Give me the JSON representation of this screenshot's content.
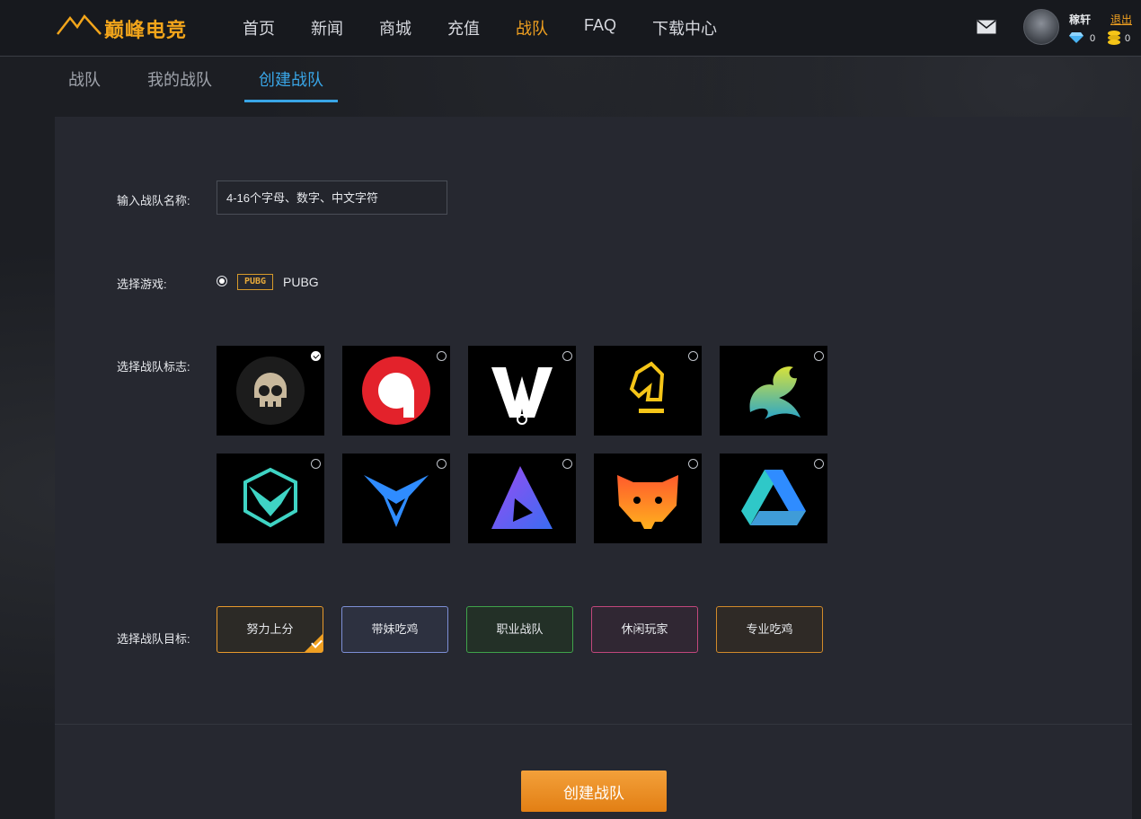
{
  "header": {
    "logo_text": "巅峰电竞",
    "nav": [
      "首页",
      "新闻",
      "商城",
      "充值",
      "战队",
      "FAQ",
      "下载中心"
    ],
    "active_nav": "战队",
    "username": "稼轩",
    "logout": "退出",
    "diamonds": "0",
    "coins": "0"
  },
  "subtabs": {
    "items": [
      "战队",
      "我的战队",
      "创建战队"
    ],
    "active": "创建战队"
  },
  "form": {
    "name_label": "输入战队名称:",
    "name_placeholder": "4-16个字母、数字、中文字符",
    "game_label": "选择游戏:",
    "game_icon_text": "PUBG",
    "game_name": "PUBG",
    "logo_label": "选择战队标志:",
    "logo_selected_index": 0,
    "logos": [
      "skull-logo",
      "g-letter-logo",
      "sy-monogram-logo",
      "horse-chess-logo",
      "dragon-logo",
      "winged-hexagon-logo",
      "blue-bird-logo",
      "purple-triangle-logo",
      "orange-cat-logo",
      "drive-triangle-logo"
    ],
    "goal_label": "选择战队目标:",
    "goals": [
      {
        "label": "努力上分",
        "color": "#e89a2c",
        "selected": true
      },
      {
        "label": "带妹吃鸡",
        "color": "#7d8fd6",
        "selected": false
      },
      {
        "label": "职业战队",
        "color": "#3fa34a",
        "selected": false
      },
      {
        "label": "休闲玩家",
        "color": "#c2477c",
        "selected": false
      },
      {
        "label": "专业吃鸡",
        "color": "#d18a2a",
        "selected": false
      }
    ],
    "submit": "创建战队"
  },
  "colors": {
    "accent": "#f0a020",
    "tab_active": "#39a5e6"
  }
}
